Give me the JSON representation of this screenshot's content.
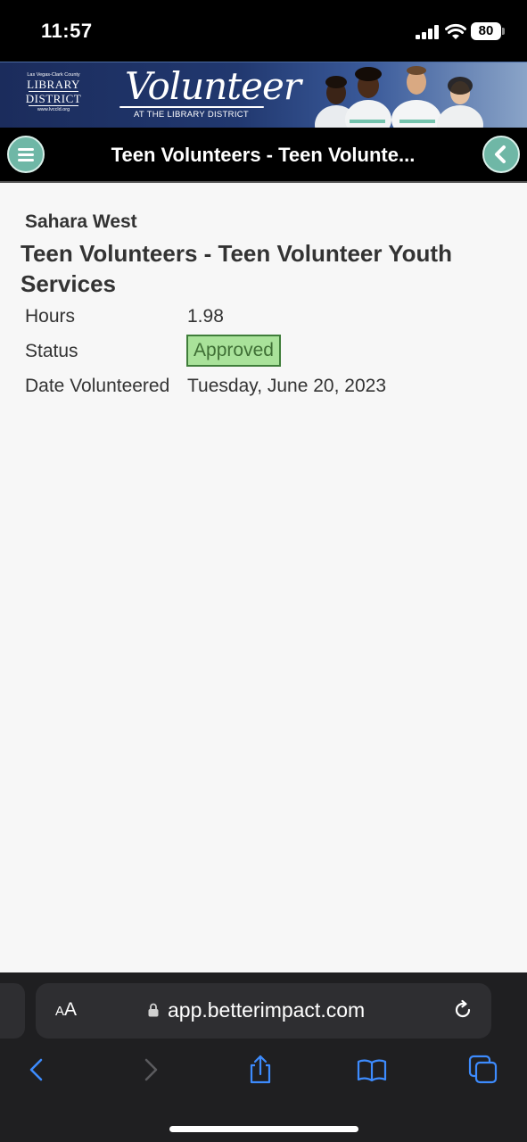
{
  "status_bar": {
    "time": "11:57",
    "battery": "80",
    "signal_icon": "cellular-signal-icon",
    "wifi_icon": "wifi-icon"
  },
  "banner": {
    "library_logo": {
      "line1": "Las Vegas-Clark County",
      "line2": "LIBRARY",
      "line3": "DISTRICT",
      "line4": "www.lvccld.org"
    },
    "title": "Volunteer",
    "subtitle": "AT THE LIBRARY DISTRICT"
  },
  "header": {
    "title": "Teen Volunteers - Teen Volunte...",
    "menu_icon": "hamburger-menu-icon",
    "back_icon": "chevron-left-icon"
  },
  "record": {
    "location": "Sahara West",
    "heading": "Teen Volunteers - Teen Volunteer Youth Services",
    "fields": {
      "hours_label": "Hours",
      "hours_value": "1.98",
      "status_label": "Status",
      "status_value": "Approved",
      "date_label": "Date Volunteered",
      "date_value": "Tuesday, June 20, 2023"
    }
  },
  "browser": {
    "text_size_label_small": "A",
    "text_size_label_large": "A",
    "url": "app.betterimpact.com",
    "toolbar": [
      "back-icon",
      "forward-icon",
      "share-icon",
      "bookmarks-icon",
      "tabs-icon"
    ]
  },
  "colors": {
    "status_badge_bg": "#a9e29a",
    "status_badge_border": "#3f7d3a",
    "header_button": "#6fb7a6",
    "safari_accent": "#3d8bfd"
  }
}
